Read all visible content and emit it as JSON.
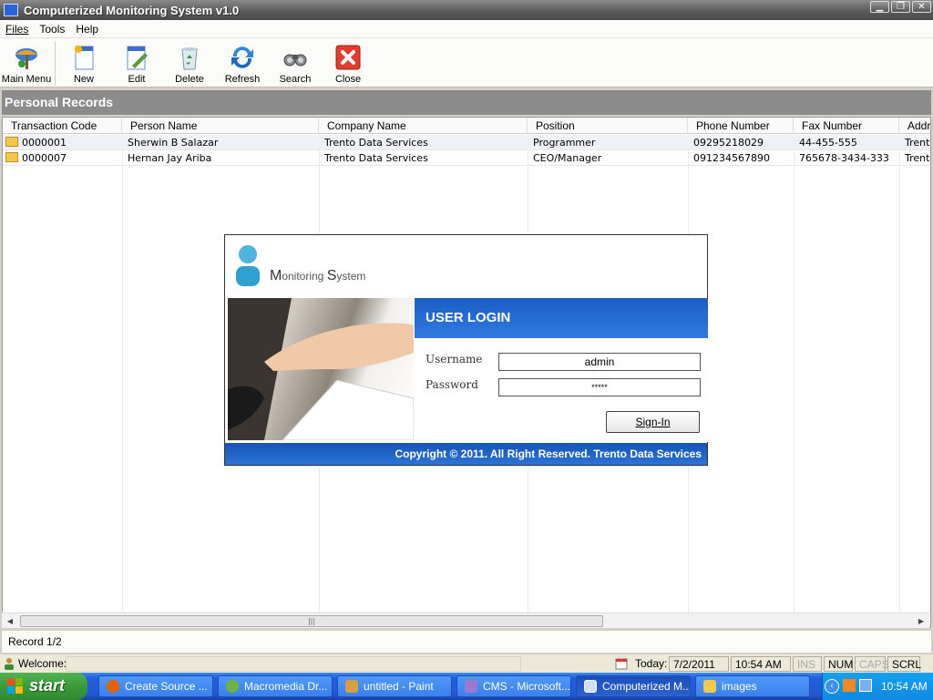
{
  "window": {
    "title": "Computerized Monitoring System v1.0",
    "controls": [
      "minimize",
      "maximize",
      "close"
    ]
  },
  "menu": {
    "items": [
      {
        "label": "Files"
      },
      {
        "label": "Tools"
      },
      {
        "label": "Help"
      }
    ]
  },
  "toolbar": {
    "buttons": [
      {
        "label": "Main Menu",
        "icon": "main-menu-icon"
      },
      {
        "label": "New",
        "icon": "new-document-icon"
      },
      {
        "label": "Edit",
        "icon": "edit-icon"
      },
      {
        "label": "Delete",
        "icon": "recycle-bin-icon"
      },
      {
        "label": "Refresh",
        "icon": "refresh-icon"
      },
      {
        "label": "Search",
        "icon": "binoculars-icon"
      },
      {
        "label": "Close",
        "icon": "close-icon"
      }
    ]
  },
  "panel": {
    "title": "Personal Records"
  },
  "grid": {
    "columns": [
      "Transaction Code",
      "Person Name",
      "Company Name",
      "Position",
      "Phone Number",
      "Fax Number",
      "Addr"
    ],
    "rows": [
      [
        "0000001",
        "Sherwin B Salazar",
        "Trento Data Services",
        "Programmer",
        "09295218029",
        "44-455-555",
        "Trent"
      ],
      [
        "0000007",
        "Hernan Jay Ariba",
        "Trento Data Services",
        "CEO/Manager",
        "091234567890",
        "765678-3434-333",
        "Trent"
      ]
    ]
  },
  "record_status": "Record 1/2",
  "statusbar": {
    "welcome_label": "Welcome:",
    "today_label": "Today:",
    "date": "7/2/2011",
    "time": "10:54 AM",
    "ins": "INS",
    "num": "NUM",
    "caps": "CAPS",
    "scrl": "SCRL"
  },
  "login": {
    "logo_initial_1": "M",
    "logo_rest_1": "onitoring ",
    "logo_initial_2": "S",
    "logo_rest_2": "ystem",
    "heading": "USER LOGIN",
    "username_label": "Username",
    "username_value": "admin",
    "password_label": "Password",
    "password_value": "*****",
    "signin_label": "Sign-In",
    "copyright": "Copyright © 2011. All Right Reserved. Trento Data Services"
  },
  "taskbar": {
    "start_label": "start",
    "tasks": [
      {
        "label": "Create Source ...",
        "icon": "firefox-icon"
      },
      {
        "label": "Macromedia Dr...",
        "icon": "dreamweaver-icon"
      },
      {
        "label": "untitled - Paint",
        "icon": "paint-icon"
      },
      {
        "label": "CMS - Microsoft...",
        "icon": "visual-studio-icon"
      },
      {
        "label": "Computerized M...",
        "icon": "app-window-icon"
      },
      {
        "label": "images",
        "icon": "folder-icon"
      }
    ],
    "clock": "10:54 AM"
  }
}
